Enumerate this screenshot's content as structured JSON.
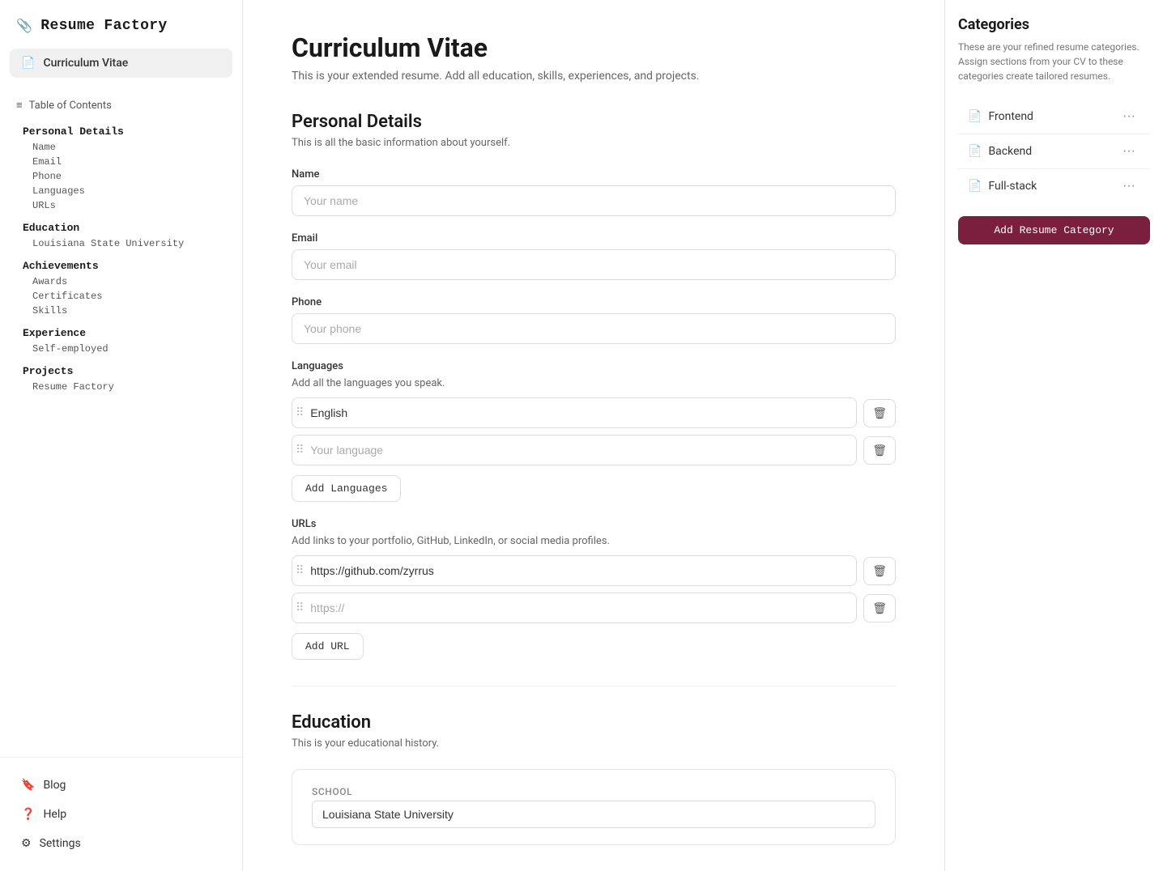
{
  "app": {
    "name": "Resume Factory",
    "logo_icon": "📎"
  },
  "sidebar": {
    "nav": [
      {
        "id": "curriculum-vitae",
        "label": "Curriculum Vitae",
        "active": true,
        "icon": "file"
      }
    ],
    "toc": {
      "header": "Table of Contents",
      "sections": [
        {
          "title": "Personal Details",
          "items": [
            "Name",
            "Email",
            "Phone",
            "Languages",
            "URLs"
          ]
        },
        {
          "title": "Education",
          "items": [
            "Louisiana State University"
          ]
        },
        {
          "title": "Achievements",
          "items": [
            "Awards",
            "Certificates",
            "Skills"
          ]
        },
        {
          "title": "Experience",
          "items": [
            "Self-employed"
          ]
        },
        {
          "title": "Projects",
          "items": [
            "Resume Factory"
          ]
        }
      ]
    },
    "footer": [
      {
        "id": "blog",
        "label": "Blog",
        "icon": "bookmark"
      },
      {
        "id": "help",
        "label": "Help",
        "icon": "circle-question"
      },
      {
        "id": "settings",
        "label": "Settings",
        "icon": "gear"
      }
    ]
  },
  "main": {
    "page_title": "Curriculum Vitae",
    "page_subtitle": "This is your extended resume. Add all education, skills, experiences, and projects.",
    "personal_details": {
      "title": "Personal Details",
      "subtitle": "This is all the basic information about yourself.",
      "name_label": "Name",
      "name_placeholder": "Your name",
      "email_label": "Email",
      "email_placeholder": "Your email",
      "phone_label": "Phone",
      "phone_placeholder": "Your phone",
      "languages_label": "Languages",
      "languages_subtitle": "Add all the languages you speak.",
      "languages": [
        {
          "value": "English",
          "placeholder": "Your language"
        },
        {
          "value": "",
          "placeholder": "Your language"
        }
      ],
      "add_language_btn": "Add Languages",
      "urls_label": "URLs",
      "urls_subtitle": "Add links to your portfolio, GitHub, LinkedIn, or social media profiles.",
      "urls": [
        {
          "value": "https://github.com/zyrrus",
          "placeholder": "https://"
        },
        {
          "value": "",
          "placeholder": "https://"
        }
      ],
      "add_url_btn": "Add URL"
    },
    "education": {
      "title": "Education",
      "subtitle": "This is your educational history.",
      "school_label": "School",
      "school_value": "Louisiana State University"
    }
  },
  "right_panel": {
    "title": "Categories",
    "description": "These are your refined resume categories. Assign sections from your CV to these categories create tailored resumes.",
    "categories": [
      {
        "id": "frontend",
        "label": "Frontend",
        "icon": "file"
      },
      {
        "id": "backend",
        "label": "Backend",
        "icon": "file"
      },
      {
        "id": "fullstack",
        "label": "Full-stack",
        "icon": "file"
      }
    ],
    "add_btn": "Add Resume Category"
  },
  "icons": {
    "drag_handle": "⠿",
    "trash": "🗑",
    "more": "···",
    "bookmark": "🔖",
    "help": "❓",
    "gear": "⚙",
    "file": "📄",
    "list": "≡"
  }
}
